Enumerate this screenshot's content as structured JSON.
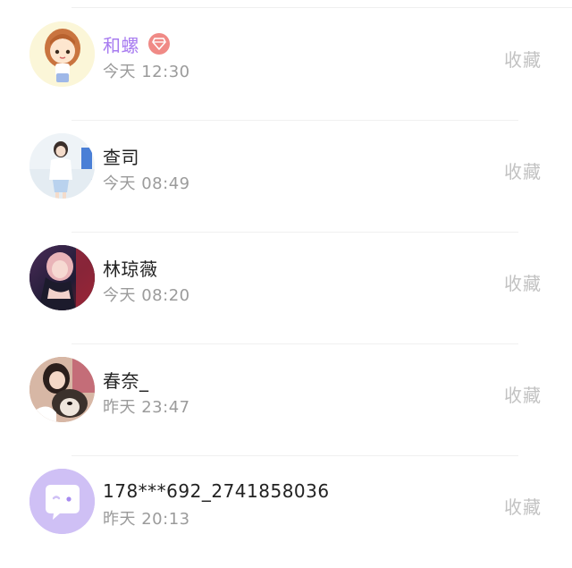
{
  "favorites": {
    "action_label": "收藏",
    "items": [
      {
        "name": "和螺",
        "time": "今天 12:30",
        "vip": true,
        "avatar_icon": "girl-cartoon-avatar"
      },
      {
        "name": "查司",
        "time": "今天 08:49",
        "vip": false,
        "avatar_icon": "girl-photo-avatar"
      },
      {
        "name": "林琼薇",
        "time": "今天 08:20",
        "vip": false,
        "avatar_icon": "woman-photo-avatar"
      },
      {
        "name": "春奈_",
        "time": "昨天 23:47",
        "vip": false,
        "avatar_icon": "woman-with-dog-avatar"
      },
      {
        "name": "178***692_2741858036",
        "time": "昨天 20:13",
        "vip": false,
        "avatar_icon": "default-chat-avatar"
      }
    ]
  },
  "colors": {
    "vip_name": "#a87cf0",
    "vip_badge": "#f08a86",
    "default_avatar_bg": "#cfc0f5",
    "action_text": "#c2c2c2",
    "time_text": "#9b9b9b"
  }
}
